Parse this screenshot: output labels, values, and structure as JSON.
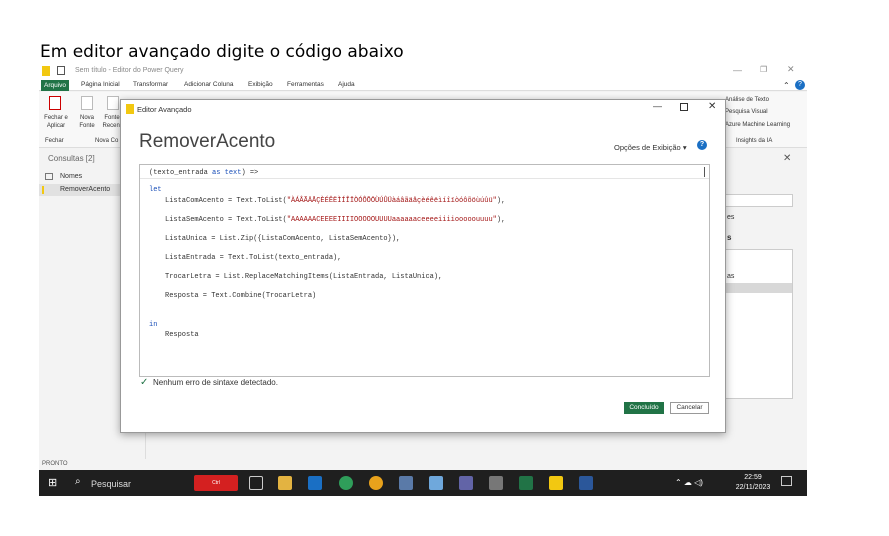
{
  "slide_title": "Em editor avançado digite o código abaixo",
  "app": {
    "title": "Sem título - Editor do Power Query",
    "menu": [
      "Arquivo",
      "Página Inicial",
      "Transformar",
      "Adicionar Coluna",
      "Exibição",
      "Ferramentas",
      "Ajuda"
    ],
    "ribbon": {
      "close_apply": "Fechar e Aplicar",
      "new_source": "Nova Fonte",
      "recent": "Fonte Recent",
      "group_close": "Fechar",
      "group_new": "Nova Co",
      "right_items": [
        "Análise de Texto",
        "Pesquisa Visual",
        "Azure Machine Learning"
      ],
      "insights": "Insights da IA"
    },
    "queries": {
      "header": "Consultas [2]",
      "items": [
        "Nomes",
        "RemoverAcento"
      ]
    },
    "right_fragments": [
      "es",
      "s",
      "as"
    ],
    "status": "PRONTO"
  },
  "dialog": {
    "title": "Editor Avançado",
    "query_name": "RemoverAcento",
    "display_options": "Opções de Exibição",
    "code": {
      "line1_a": "(texto_entrada ",
      "line1_kw": "as",
      "line1_b": " ",
      "line1_kw2": "text",
      "line1_c": ") =>",
      "let": "let",
      "l1_a": "ListaComAcento = Text.ToList(",
      "l1_str": "\"ÀÁÂÃÄÅÇÈÉÊËÌÍÎÏÒÓÔÕÖÙÚÛÜàáâãäåçèéêëìíîïòóôõöùúûü\"",
      "l1_b": "),",
      "l2_a": "ListaSemAcento = Text.ToList(",
      "l2_str": "\"AAAAAACEEEEIIIIOOOOOUUUUaaaaaaceeeeiiiiooooouuuu\"",
      "l2_b": "),",
      "l3": "ListaUnica = List.Zip({ListaComAcento, ListaSemAcento}),",
      "l4": "ListaEntrada = Text.ToList(texto_entrada),",
      "l5": "TrocarLetra = List.ReplaceMatchingItems(ListaEntrada, ListaUnica),",
      "l6": "Resposta = Text.Combine(TrocarLetra)",
      "in": "in",
      "result": "Resposta"
    },
    "status": "Nenhum erro de sintaxe detectado.",
    "ok": "Concluído",
    "cancel": "Cancelar"
  },
  "taskbar": {
    "search_placeholder": "Pesquisar",
    "ctrl_badge": "Ctrl",
    "time": "22:59",
    "date": "22/11/2023"
  }
}
